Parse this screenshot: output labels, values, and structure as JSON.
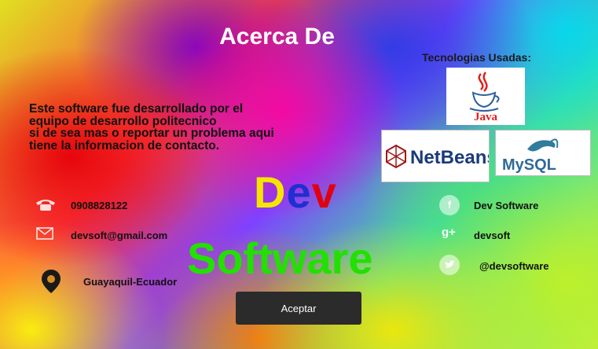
{
  "window": {
    "title": "Acerca De"
  },
  "technologies": {
    "heading": "Tecnologias Usadas:",
    "logos": [
      {
        "name": "Java",
        "label": "Java"
      },
      {
        "name": "NetBeans",
        "label": "NetBeans"
      },
      {
        "name": "MySQL",
        "label": "MySQL"
      }
    ]
  },
  "description": {
    "lines": [
      "Este software fue desarrollado por el",
      "equipo de desarrollo politecnico",
      "si de sea mas o reportar un problema aqui",
      "tiene la informacion de contacto."
    ]
  },
  "brand": {
    "line1": [
      "D",
      "e",
      "v"
    ],
    "line2": "Software",
    "colors": {
      "d": "#f5e600",
      "e": "#1f2fd0",
      "v": "#e00010",
      "software": "#22e000"
    }
  },
  "contacts": {
    "phone": "0908828122",
    "email": "devsoft@gmail.com",
    "location": "Guayaquil-Ecuador"
  },
  "social": {
    "facebook": "Dev Software",
    "google_plus": "devsoft",
    "twitter": "@devsoftware"
  },
  "actions": {
    "accept_label": "Aceptar"
  }
}
